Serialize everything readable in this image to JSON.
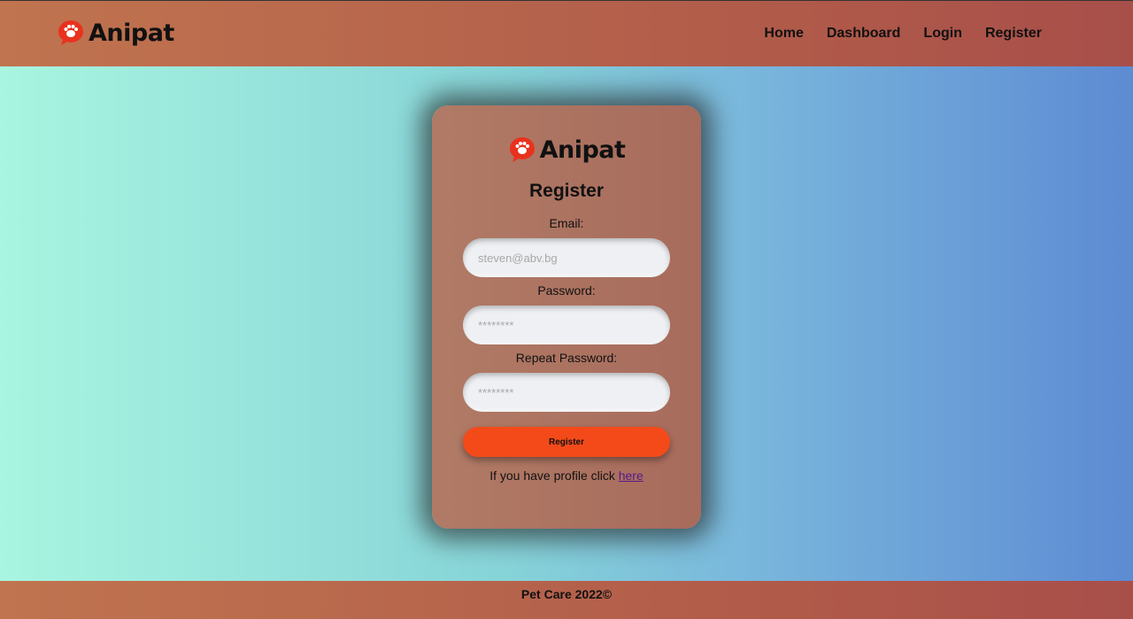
{
  "header": {
    "brand": "Anipat",
    "nav": [
      "Home",
      "Dashboard",
      "Login",
      "Register"
    ]
  },
  "card": {
    "brand": "Anipat",
    "title": "Register",
    "email_label": "Email:",
    "email_placeholder": "steven@abv.bg",
    "password_label": "Password:",
    "password_placeholder": "********",
    "repeat_label": "Repeat Password:",
    "repeat_placeholder": "********",
    "submit_label": "Register",
    "hint_text": "If you have profile click ",
    "hint_link": "here"
  },
  "footer": {
    "text": "Pet Care 2022©"
  },
  "colors": {
    "accent": "#f44a1a",
    "logo": "#e8321e",
    "header_bg": "#b6614c"
  }
}
